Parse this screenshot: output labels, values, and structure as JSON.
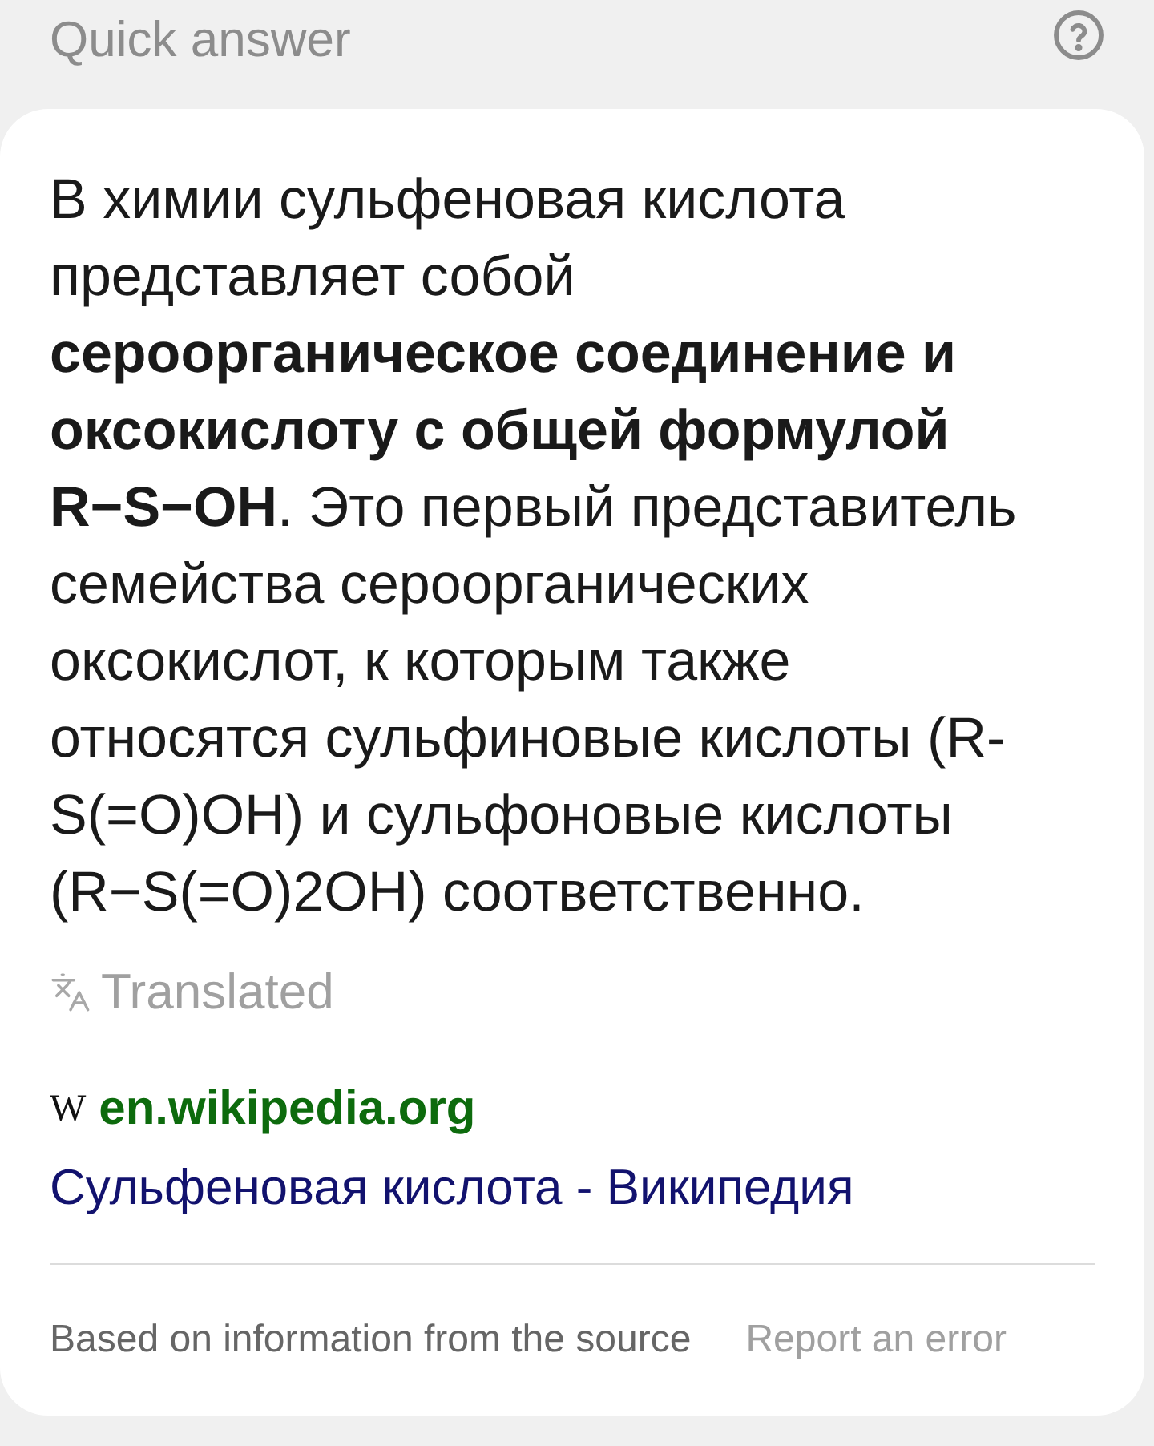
{
  "header": {
    "title": "Quick answer"
  },
  "answer": {
    "text": "В химии сульфеновая кислота представляет собой **сероорганическое соединение и оксокислоту с общей формулой R−S−OH**. Это первый представитель семейства сероорганических оксокислот, к которым также относятся сульфиновые кислоты (R-S(=O)OH) и сульфоновые кислоты (R−S(=O)2OH) соответственно.",
    "translated_label": "Translated"
  },
  "source": {
    "logo": "W",
    "domain": "en.wikipedia.org",
    "title": "Сульфеновая кислота - Википедия"
  },
  "footer": {
    "note": "Based on information from the source",
    "report_link": "Report an error"
  }
}
